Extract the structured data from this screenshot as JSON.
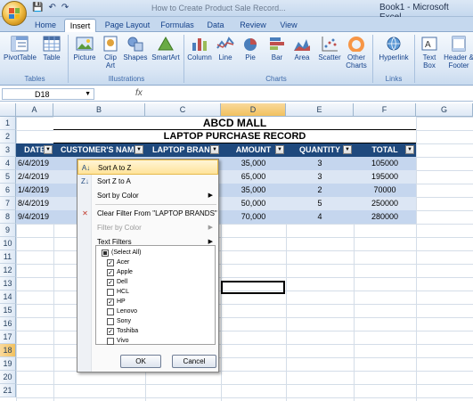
{
  "window": {
    "doc_title": "How to Create Product Sale Record...",
    "app_title": "Book1 - Microsoft Excel"
  },
  "qat": {
    "save": "💾",
    "undo": "↶",
    "redo": "↷"
  },
  "tabs": [
    {
      "label": "Home"
    },
    {
      "label": "Insert"
    },
    {
      "label": "Page Layout"
    },
    {
      "label": "Formulas"
    },
    {
      "label": "Data"
    },
    {
      "label": "Review"
    },
    {
      "label": "View"
    }
  ],
  "ribbon": {
    "buttons": [
      {
        "label": "PivotTable",
        "icon": "pivottable-icon"
      },
      {
        "label": "Table",
        "icon": "table-icon"
      },
      {
        "label": "Picture",
        "icon": "picture-icon"
      },
      {
        "label": "Clip Art",
        "icon": "clipart-icon"
      },
      {
        "label": "Shapes",
        "icon": "shapes-icon"
      },
      {
        "label": "SmartArt",
        "icon": "smartart-icon"
      },
      {
        "label": "Column",
        "icon": "column-chart-icon"
      },
      {
        "label": "Line",
        "icon": "line-chart-icon"
      },
      {
        "label": "Pie",
        "icon": "pie-chart-icon"
      },
      {
        "label": "Bar",
        "icon": "bar-chart-icon"
      },
      {
        "label": "Area",
        "icon": "area-chart-icon"
      },
      {
        "label": "Scatter",
        "icon": "scatter-chart-icon"
      },
      {
        "label": "Other Charts",
        "icon": "other-charts-icon"
      },
      {
        "label": "Hyperlink",
        "icon": "hyperlink-icon"
      },
      {
        "label": "Text Box",
        "icon": "textbox-icon"
      },
      {
        "label": "Header & Footer",
        "icon": "header-footer-icon"
      }
    ],
    "groups": [
      {
        "label": "Tables"
      },
      {
        "label": "Illustrations"
      },
      {
        "label": "Charts"
      },
      {
        "label": "Links"
      }
    ]
  },
  "formula_bar": {
    "name_box": "D18",
    "fx": "fx",
    "value": ""
  },
  "columns": [
    "A",
    "B",
    "C",
    "D",
    "E",
    "F",
    "G"
  ],
  "rows": [
    "1",
    "2",
    "3",
    "4",
    "5",
    "6",
    "7",
    "8",
    "9",
    "10",
    "11",
    "12",
    "13",
    "14",
    "15",
    "16",
    "17",
    "18",
    "19",
    "20",
    "21"
  ],
  "sheet": {
    "title": "ABCD MALL",
    "subtitle": "LAPTOP PURCHASE RECORD",
    "headers": [
      "DATE",
      "CUSTOMER'S NAM",
      "LAPTOP BRAND",
      "AMOUNT",
      "QUANTITY",
      "TOTAL"
    ],
    "records": [
      {
        "date": "6/4/2019",
        "amount": "35,000",
        "qty": "3",
        "total": "105000"
      },
      {
        "date": "2/4/2019",
        "amount": "65,000",
        "qty": "3",
        "total": "195000"
      },
      {
        "date": "1/4/2019",
        "amount": "35,000",
        "qty": "2",
        "total": "70000"
      },
      {
        "date": "8/4/2019",
        "amount": "50,000",
        "qty": "5",
        "total": "250000"
      },
      {
        "date": "9/4/2019",
        "amount": "70,000",
        "qty": "4",
        "total": "280000"
      }
    ]
  },
  "filter_menu": {
    "sort_az": "Sort A to Z",
    "sort_za": "Sort Z to A",
    "sort_color": "Sort by Color",
    "clear_filter": "Clear Filter From \"LAPTOP BRANDS\"",
    "filter_color": "Filter by Color",
    "text_filters": "Text Filters",
    "items": [
      {
        "label": "(Select All)",
        "state": "partial"
      },
      {
        "label": "Acer",
        "state": "checked"
      },
      {
        "label": "Apple",
        "state": "checked"
      },
      {
        "label": "Dell",
        "state": "checked"
      },
      {
        "label": "HCL",
        "state": "unchecked"
      },
      {
        "label": "HP",
        "state": "checked"
      },
      {
        "label": "Lenovo",
        "state": "unchecked"
      },
      {
        "label": "Sony",
        "state": "unchecked"
      },
      {
        "label": "Toshiba",
        "state": "checked"
      },
      {
        "label": "Vivo",
        "state": "unchecked"
      }
    ],
    "ok": "OK",
    "cancel": "Cancel"
  },
  "colors": {
    "header_fill": "#1f497d",
    "row_band_a": "#c5d6ee",
    "row_band_b": "#dce6f4",
    "accent": "#15428b"
  }
}
